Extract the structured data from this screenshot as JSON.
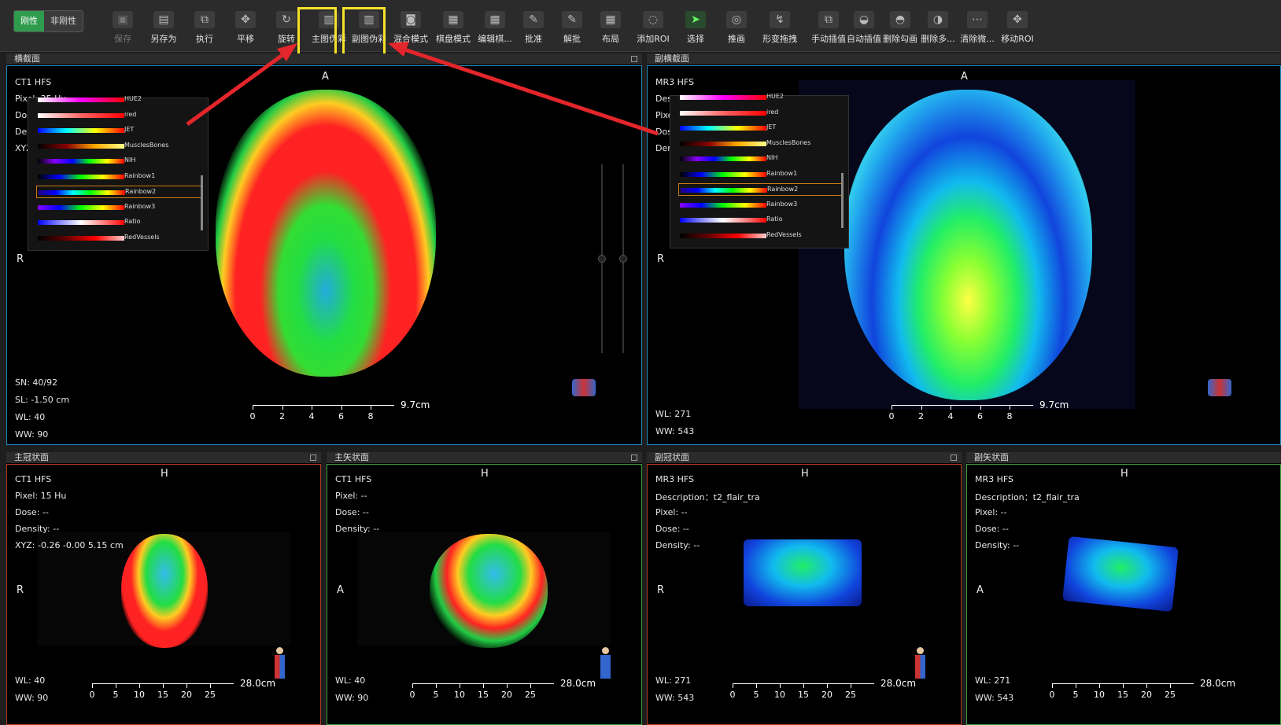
{
  "colors": {
    "accent": "#2e9b4d",
    "highlight": "#f5e12a",
    "arrow": "#e3262b",
    "pane_axial_border": "#1f8ab8",
    "pane_coronal_border": "#b33a1f",
    "pane_sagittal_border": "#3c9c3c",
    "lut_selected": "#c97d16"
  },
  "toolbar": {
    "mode": {
      "rigid": "刚性",
      "nonrigid": "非刚性"
    },
    "tools": [
      {
        "label": "保存",
        "icon": "save-icon"
      },
      {
        "label": "另存为",
        "icon": "save-as-icon"
      },
      {
        "label": "执行",
        "icon": "execute-icon"
      },
      {
        "label": "平移",
        "icon": "pan-2d-icon"
      },
      {
        "label": "旋转",
        "icon": "rotate-icon"
      },
      {
        "label": "主图伪彩",
        "icon": "main-pseudocolor-icon"
      },
      {
        "label": "副图伪彩",
        "icon": "secondary-pseudocolor-icon"
      },
      {
        "label": "混合模式",
        "icon": "blend-mode-icon"
      },
      {
        "label": "棋盘模式",
        "icon": "checkerboard-icon"
      },
      {
        "label": "编辑棋...",
        "icon": "edit-checkerboard-icon"
      },
      {
        "label": "批准",
        "icon": "approve-icon"
      },
      {
        "label": "解批",
        "icon": "unapprove-icon"
      },
      {
        "label": "布局",
        "icon": "layout-icon"
      },
      {
        "label": "添加ROI",
        "icon": "add-roi-icon"
      },
      {
        "label": "选择",
        "icon": "select-cursor-icon"
      },
      {
        "label": "推画",
        "icon": "push-draw-icon"
      },
      {
        "label": "形变拖拽",
        "icon": "deform-drag-icon"
      },
      {
        "label": "手动插值",
        "icon": "manual-interp-icon"
      },
      {
        "label": "自动插值",
        "icon": "auto-interp-icon"
      },
      {
        "label": "删除勾画",
        "icon": "delete-contour-icon"
      },
      {
        "label": "删除多...",
        "icon": "delete-multi-icon"
      },
      {
        "label": "清除微...",
        "icon": "clear-micro-icon"
      },
      {
        "label": "移动ROI",
        "icon": "move-roi-3d-icon"
      }
    ]
  },
  "lut_names": [
    "HUE2",
    "ired",
    "JET",
    "MusclesBones",
    "NIH",
    "Rainbow1",
    "Rainbow2",
    "Rainbow3",
    "Ratio",
    "RedVessels"
  ],
  "panes": {
    "main_axial": {
      "title": "横截面",
      "orient_top": "A",
      "orient_left": "R",
      "lines": [
        "CT1 HFS",
        "Pixel:  35 Hu",
        "Dos",
        "Der",
        "XYZ"
      ],
      "bottom": [
        "SN: 40/92",
        "SL: -1.50 cm",
        "WL:  40",
        "WW:  90"
      ],
      "scale_len": "9.7cm"
    },
    "sec_axial": {
      "title": "副横截面",
      "orient_top": "A",
      "orient_left": "R",
      "lines": [
        "MR3 HFS",
        "Des",
        "Pixe",
        "Dos",
        "Der"
      ],
      "bottom": [
        "WL:  271",
        "WW:  543"
      ],
      "scale_len": "9.7cm"
    },
    "main_coronal": {
      "title": "主冠状面",
      "orient_top": "H",
      "orient_left": "R",
      "lines": [
        "CT1 HFS",
        "Pixel:  15 Hu",
        "Dose:  --",
        "Density:  --",
        "XYZ: -0.26 -0.00 5.15 cm"
      ],
      "bottom": [
        "WL:  40",
        "WW:  90"
      ],
      "scale_len": "28.0cm"
    },
    "main_sagittal": {
      "title": "主矢状面",
      "orient_top": "H",
      "orient_left": "A",
      "lines": [
        "CT1 HFS",
        "Pixel:  --",
        "Dose:  --",
        "Density:  --"
      ],
      "bottom": [
        "WL:  40",
        "WW:  90"
      ],
      "scale_len": "28.0cm"
    },
    "sec_coronal": {
      "title": "副冠状面",
      "orient_top": "H",
      "orient_left": "R",
      "lines": [
        "MR3 HFS",
        "Description：t2_flair_tra",
        "Pixel:  --",
        "Dose:  --",
        "Density:  --"
      ],
      "bottom": [
        "WL:  271",
        "WW:  543"
      ],
      "scale_len": "28.0cm"
    },
    "sec_sagittal": {
      "title": "副矢状面",
      "orient_top": "H",
      "orient_left": "A",
      "lines": [
        "MR3 HFS",
        "Description：t2_flair_tra",
        "Pixel:  --",
        "Dose:  --",
        "Density:  --"
      ],
      "bottom": [
        "WL:  271",
        "WW:  543"
      ],
      "scale_len": "28.0cm"
    }
  },
  "scale_ticks_small": [
    "0",
    "2",
    "4",
    "6",
    "8"
  ],
  "scale_ticks_large": [
    "0",
    "5",
    "10",
    "15",
    "20",
    "25"
  ]
}
